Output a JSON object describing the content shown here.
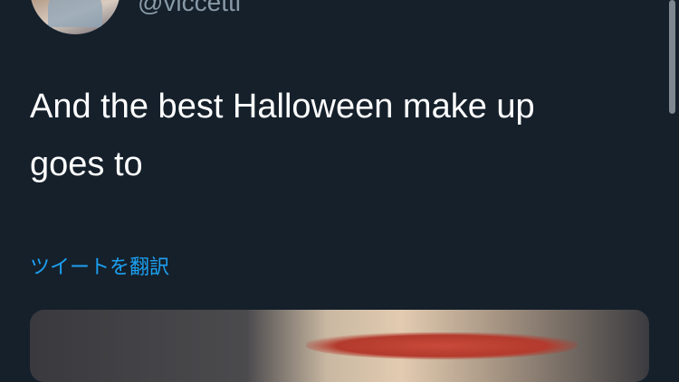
{
  "tweet": {
    "handle": "@viccetti",
    "text": "And the best Halloween make up goes to",
    "translate_label": "ツイートを翻訳"
  },
  "icons": {
    "avatar": "user-avatar-photo",
    "media": "tweet-photo"
  },
  "colors": {
    "background": "#15202b",
    "text_primary": "#ffffff",
    "text_secondary": "#8899a6",
    "link": "#1da1f2"
  }
}
